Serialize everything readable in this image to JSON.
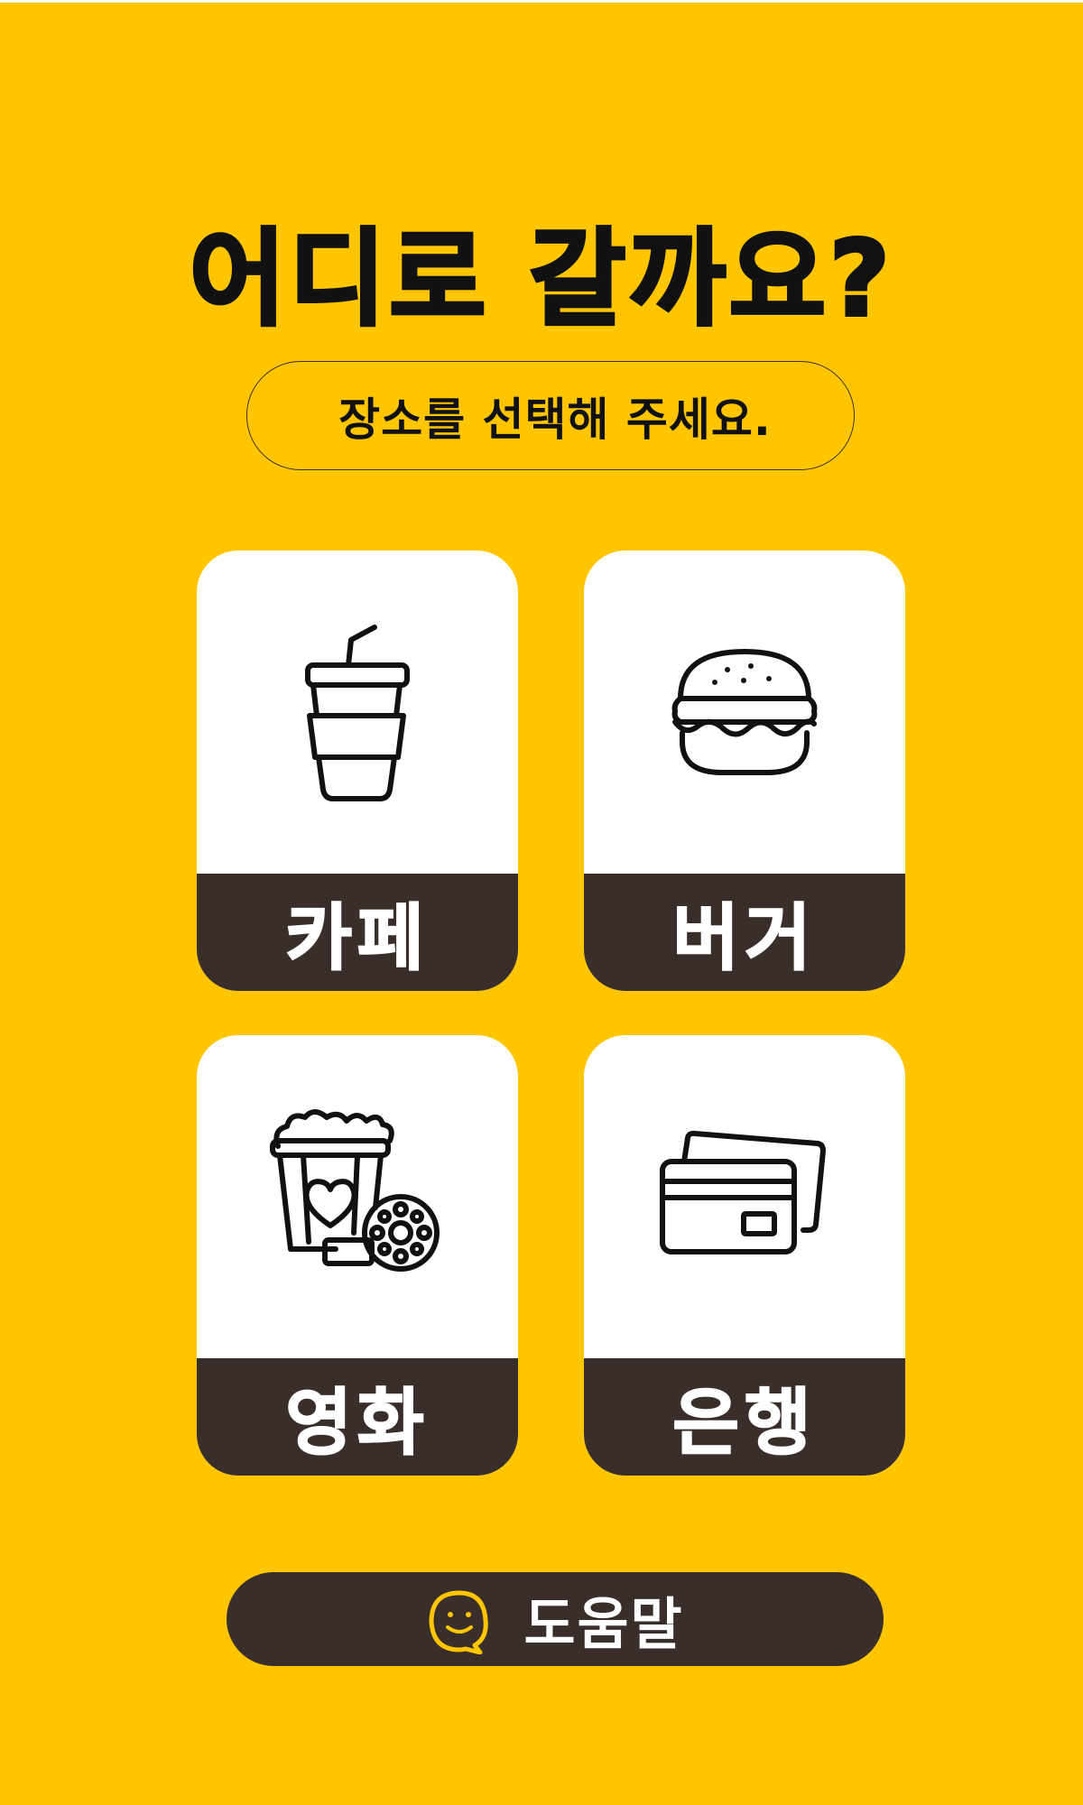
{
  "header": {
    "title": "어디로 갈까요?",
    "subtitle": "장소를 선택해 주세요."
  },
  "options": [
    {
      "label": "카페",
      "icon": "drink-cup-icon"
    },
    {
      "label": "버거",
      "icon": "burger-icon"
    },
    {
      "label": "영화",
      "icon": "popcorn-film-icon"
    },
    {
      "label": "은행",
      "icon": "credit-card-icon"
    }
  ],
  "help": {
    "label": "도움말",
    "icon": "smile-chat-icon"
  },
  "colors": {
    "background": "#FFC600",
    "label_bar": "#3a2e2a",
    "tile": "#ffffff",
    "text_dark": "#111111"
  }
}
